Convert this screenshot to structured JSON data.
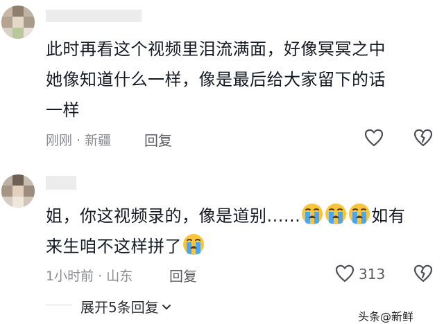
{
  "comments": [
    {
      "text_lines": [
        "此时再看这个视频里泪流满面，好像冥冥之中",
        "她像知道什么一样，像是最后给大家留下的话",
        "一样"
      ],
      "meta": "刚刚 · 新疆",
      "reply_label": "回复",
      "like_count": ""
    },
    {
      "text_part1": "姐，你这视频录的，像是道别......",
      "text_part2": "如有",
      "text_line2": "来生咱不这样拼了",
      "emoji_name": "crying-face",
      "meta": "1小时前 · 山东",
      "reply_label": "回复",
      "like_count": "313"
    }
  ],
  "expand_replies": "展开5条回复",
  "watermark": "头条@新鲜"
}
